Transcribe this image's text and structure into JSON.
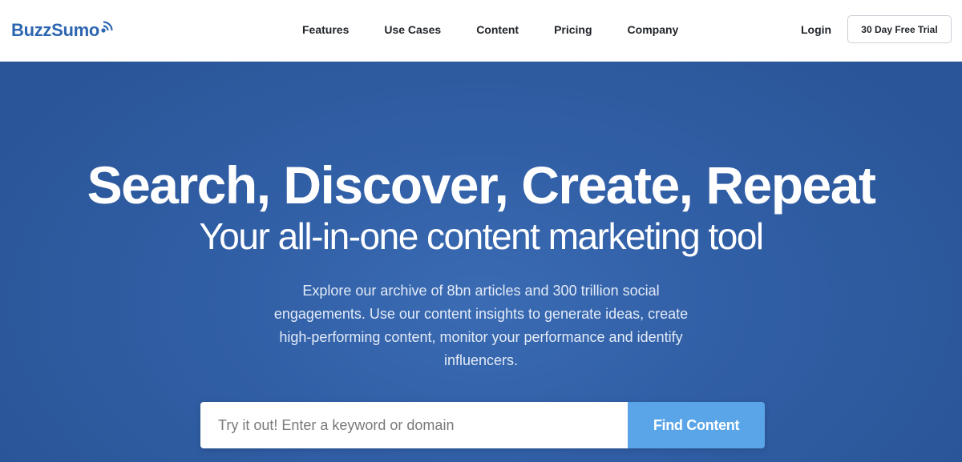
{
  "brand": {
    "name": "BuzzSumo",
    "color": "#2d66b0"
  },
  "nav": {
    "items": [
      {
        "label": "Features"
      },
      {
        "label": "Use Cases"
      },
      {
        "label": "Content"
      },
      {
        "label": "Pricing"
      },
      {
        "label": "Company"
      }
    ],
    "login_label": "Login",
    "trial_label": "30 Day Free Trial"
  },
  "hero": {
    "headline": "Search, Discover, Create, Repeat",
    "subhead": "Your all-in-one content marketing tool",
    "description": "Explore our archive of 8bn articles and 300 trillion social engagements. Use our content insights to generate ideas, create high-performing content, monitor your performance and identify influencers.",
    "background_color": "#2f5da3"
  },
  "search": {
    "placeholder": "Try it out! Enter a keyword or domain",
    "value": "",
    "button_label": "Find Content",
    "button_color": "#5aa5e8"
  },
  "icons": {
    "logo": "signal-waves-icon"
  }
}
